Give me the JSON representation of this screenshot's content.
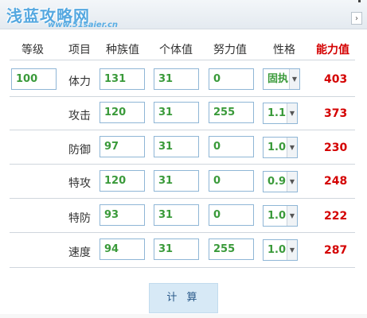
{
  "watermark": {
    "title": "浅蓝攻略网",
    "url": "www.51saier.cn"
  },
  "toolbar": {
    "collapse_icon": "chevron-right-icon",
    "collapse_glyph": "›"
  },
  "headers": {
    "level": "等级",
    "item": "项目",
    "base": "种族值",
    "iv": "个体值",
    "ev": "努力值",
    "nature": "性格",
    "stat": "能力值"
  },
  "level": "100",
  "rows": [
    {
      "label": "体力",
      "base": "131",
      "iv": "31",
      "ev": "0",
      "nature": "固执",
      "stat": "403"
    },
    {
      "label": "攻击",
      "base": "120",
      "iv": "31",
      "ev": "255",
      "nature": "1.1",
      "stat": "373"
    },
    {
      "label": "防御",
      "base": "97",
      "iv": "31",
      "ev": "0",
      "nature": "1.0",
      "stat": "230"
    },
    {
      "label": "特攻",
      "base": "120",
      "iv": "31",
      "ev": "0",
      "nature": "0.9",
      "stat": "248"
    },
    {
      "label": "特防",
      "base": "93",
      "iv": "31",
      "ev": "0",
      "nature": "1.0",
      "stat": "222"
    },
    {
      "label": "速度",
      "base": "94",
      "iv": "31",
      "ev": "255",
      "nature": "1.0",
      "stat": "287"
    }
  ],
  "calc_button": "计 算",
  "colors": {
    "value_green": "#3a9a3a",
    "stat_red": "#d40000",
    "border_blue": "#8fb6d6"
  }
}
